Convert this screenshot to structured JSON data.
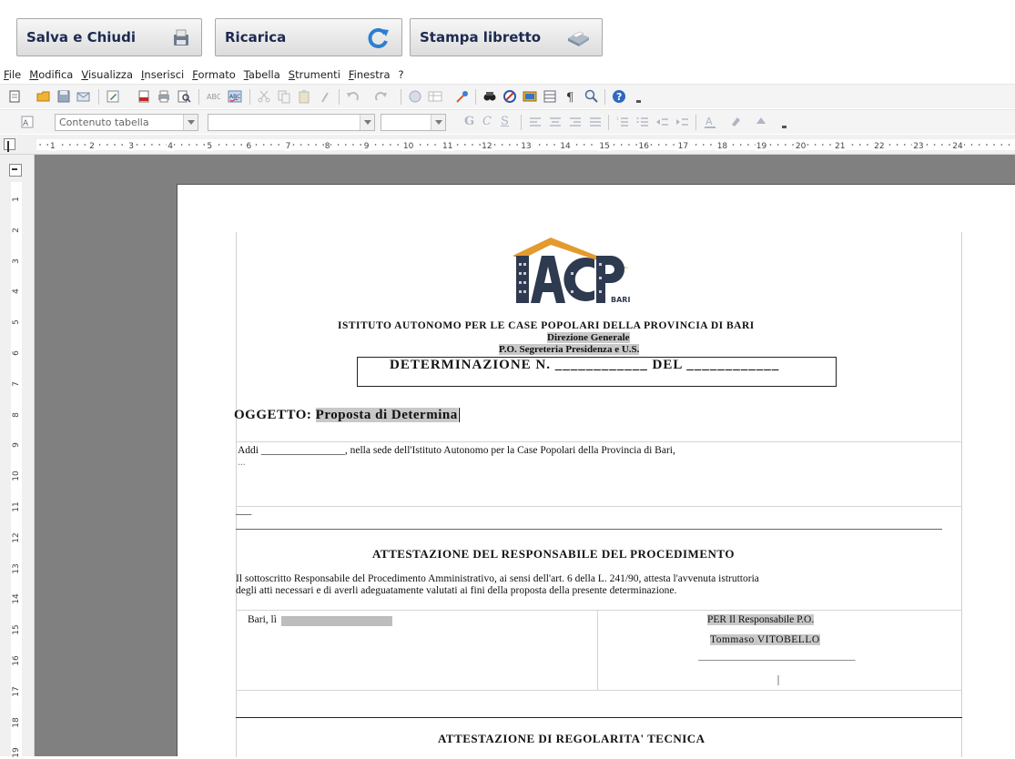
{
  "app_buttons": {
    "save_close": "Salva e Chiudi",
    "reload": "Ricarica",
    "print_booklet": "Stampa libretto"
  },
  "menu": [
    "File",
    "Modifica",
    "Visualizza",
    "Inserisci",
    "Formato",
    "Tabella",
    "Strumenti",
    "Finestra",
    "?"
  ],
  "format_toolbar": {
    "paragraph_style": "Contenuto tabella",
    "font_name": "",
    "font_size": ""
  },
  "ruler": {
    "h_numbers": [
      "1",
      "2",
      "3",
      "4",
      "5",
      "6",
      "7",
      "8",
      "9",
      "10",
      "11",
      "12",
      "13",
      "14",
      "15",
      "16",
      "17",
      "18",
      "19",
      "20",
      "21",
      "22",
      "23",
      "24"
    ],
    "v_numbers": [
      "1",
      "2",
      "3",
      "4",
      "5",
      "6",
      "7",
      "8",
      "9",
      "10",
      "11",
      "12",
      "13",
      "14",
      "15",
      "16",
      "17",
      "18",
      "19"
    ]
  },
  "document": {
    "logo_text": "IACP",
    "logo_sub": "BARI",
    "institute": "ISTITUTO AUTONOMO PER LE CASE POPOLARI DELLA PROVINCIA DI BARI",
    "directorate": "Direzione Generale",
    "office": "P.O. Segreteria Presidenza e U.S.",
    "determination_label": "DETERMINAZIONE N. ____________ DEL ____________",
    "subject_label": "OGGETTO:",
    "subject_value": "Proposta di Determina",
    "addi_line": "Addi ________________, nella sede dell'Istituto Autonomo per la Case Popolari della Provincia di Bari,",
    "ellipsis": "...",
    "short_dash": "___",
    "attestation_title": "ATTESTAZIONE DEL RESPONSABILE DEL PROCEDIMENTO",
    "attestation_line1": "Il sottoscritto Responsabile del Procedimento Amministrativo, ai sensi dell'art. 6 della L. 241/90, attesta l'avvenuta istruttoria",
    "attestation_line2": "degli atti necessari e di averli adeguatamente valutati ai fini della proposta della presente determinazione.",
    "place_date_label": "Bari, lì",
    "signer_role": "PER Il Responsabile P.O.",
    "signer_name": "Tommaso VITOBELLO",
    "signature_line": "______________________________",
    "technical_title": "ATTESTAZIONE DI REGOLARITA' TECNICA"
  }
}
